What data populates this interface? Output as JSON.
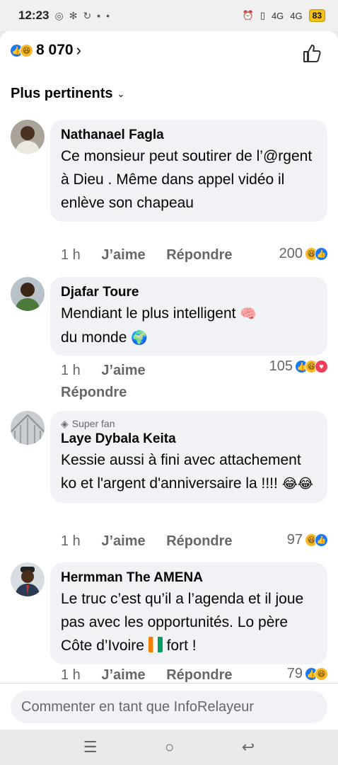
{
  "status_bar": {
    "time": "12:23",
    "network_1": "4G",
    "network_2": "4G",
    "battery": "83"
  },
  "header": {
    "reaction_count": "8 070",
    "reactions": [
      "like",
      "haha"
    ]
  },
  "sort": {
    "label": "Plus pertinents"
  },
  "actions": {
    "like": "J’aime",
    "reply": "Répondre"
  },
  "comments": [
    {
      "author": "Nathanael Fagla",
      "text": "Ce monsieur peut soutirer de l’@rgent à Dieu . Même dans appel vidéo il enlève son chapeau",
      "time": "1 h",
      "reaction_count": "200",
      "reactions": [
        "haha",
        "like"
      ]
    },
    {
      "author": "Djafar Toure",
      "text": "Mendiant le plus intelligent",
      "text_end": "du monde",
      "emoji_1": "🧠",
      "emoji_2": "🌍",
      "time": "1 h",
      "reaction_count": "105",
      "reactions": [
        "like",
        "haha",
        "love"
      ]
    },
    {
      "badge": "Super fan",
      "author": "Laye Dybala Keita",
      "text": "Kessie aussi à fini avec attachement ko et l'argent d'anniversaire la !!!!",
      "emoji": "😂😂",
      "time": "1 h",
      "reaction_count": "97",
      "reactions": [
        "haha",
        "like"
      ]
    },
    {
      "author": "Hermman The AMENA",
      "text": "Le truc c’est qu’il a l’agenda et il joue pas avec les opportunités. Lo père Côte d’Ivoire",
      "text_end": "fort !",
      "time": "1 h",
      "reaction_count": "79",
      "reactions": [
        "like",
        "haha"
      ]
    }
  ],
  "composer": {
    "placeholder": "Commenter en tant que InfoRelayeur"
  },
  "colors": {
    "like": "#1877f2",
    "haha": "#f7b928",
    "love": "#f33e58",
    "bubble": "#f0f2f5",
    "meta_text": "#65676b"
  }
}
